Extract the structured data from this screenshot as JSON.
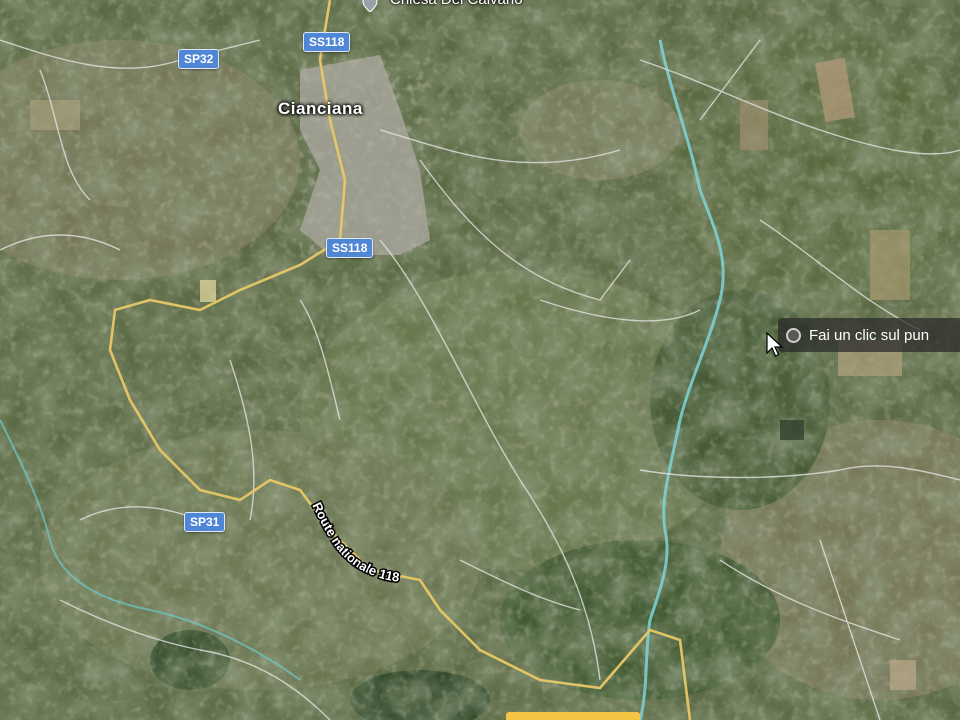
{
  "map": {
    "view": "satellite",
    "places": {
      "town": "Cianciana",
      "poi_top": "Chiesa Del Calvario"
    },
    "roads": {
      "sp32": "SP32",
      "ss118_north": "SS118",
      "ss118_town": "SS118",
      "sp31": "SP31",
      "route_label": "Route nationale 118"
    },
    "hint": {
      "text": "Fai un clic sul pun"
    },
    "colors": {
      "road_major": "#e9c766",
      "road_minor": "#e8e8e8",
      "river": "#7fd3d8",
      "shield_blue": "#4f86d6"
    }
  }
}
